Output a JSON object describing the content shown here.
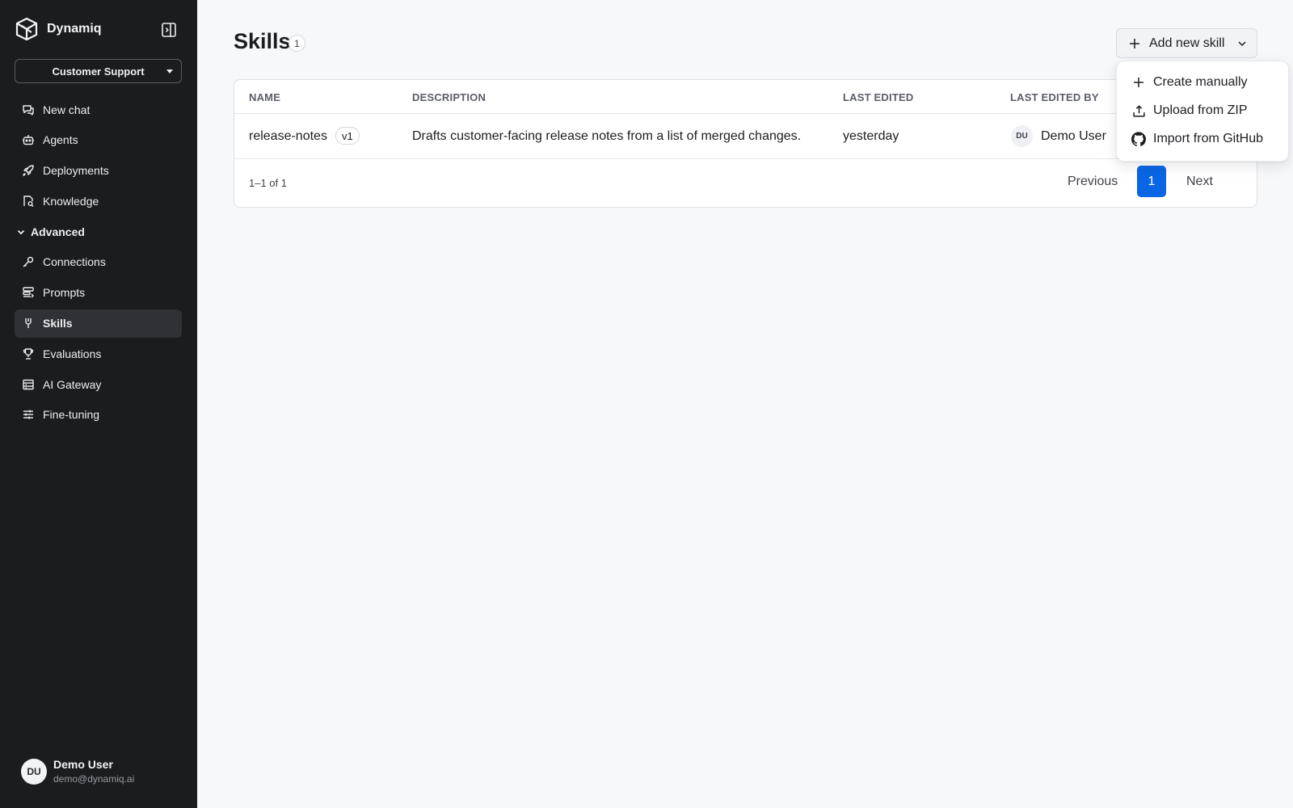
{
  "brand": {
    "name": "Dynamiq"
  },
  "workspace": {
    "selected": "Customer Support"
  },
  "nav": {
    "primary": [
      {
        "label": "New chat",
        "icon": "chat-icon"
      },
      {
        "label": "Agents",
        "icon": "bot-icon"
      },
      {
        "label": "Deployments",
        "icon": "rocket-icon"
      },
      {
        "label": "Knowledge",
        "icon": "knowledge-icon"
      }
    ],
    "section_label": "Advanced",
    "advanced": [
      {
        "label": "Connections",
        "icon": "key-icon"
      },
      {
        "label": "Prompts",
        "icon": "prompts-icon"
      },
      {
        "label": "Skills",
        "icon": "skills-icon",
        "active": true
      },
      {
        "label": "Evaluations",
        "icon": "trophy-icon"
      },
      {
        "label": "AI Gateway",
        "icon": "gateway-icon"
      },
      {
        "label": "Fine-tuning",
        "icon": "sliders-icon"
      }
    ]
  },
  "user": {
    "initials": "DU",
    "name": "Demo User",
    "email": "demo@dynamiq.ai"
  },
  "page": {
    "title": "Skills",
    "count": "1"
  },
  "add_button": {
    "label": "Add new skill"
  },
  "dropdown": {
    "items": [
      {
        "label": "Create manually",
        "icon": "plus-icon"
      },
      {
        "label": "Upload from ZIP",
        "icon": "upload-icon"
      },
      {
        "label": "Import from GitHub",
        "icon": "github-icon"
      }
    ]
  },
  "table": {
    "headers": {
      "name": "NAME",
      "description": "DESCRIPTION",
      "last_edited": "LAST EDITED",
      "last_edited_by": "LAST EDITED BY"
    },
    "rows": [
      {
        "name": "release-notes",
        "version": "v1",
        "description": "Drafts customer-facing release notes from a list of merged changes.",
        "last_edited": "yesterday",
        "editor_initials": "DU",
        "editor_name": "Demo User"
      }
    ]
  },
  "pagination": {
    "range": "1–1 of 1",
    "previous": "Previous",
    "current": "1",
    "next": "Next"
  },
  "colors": {
    "sidebar_bg": "#1b1c20",
    "active_item_bg": "#2f3137",
    "accent": "#0a66e4",
    "page_bg": "#f7f8fa"
  }
}
